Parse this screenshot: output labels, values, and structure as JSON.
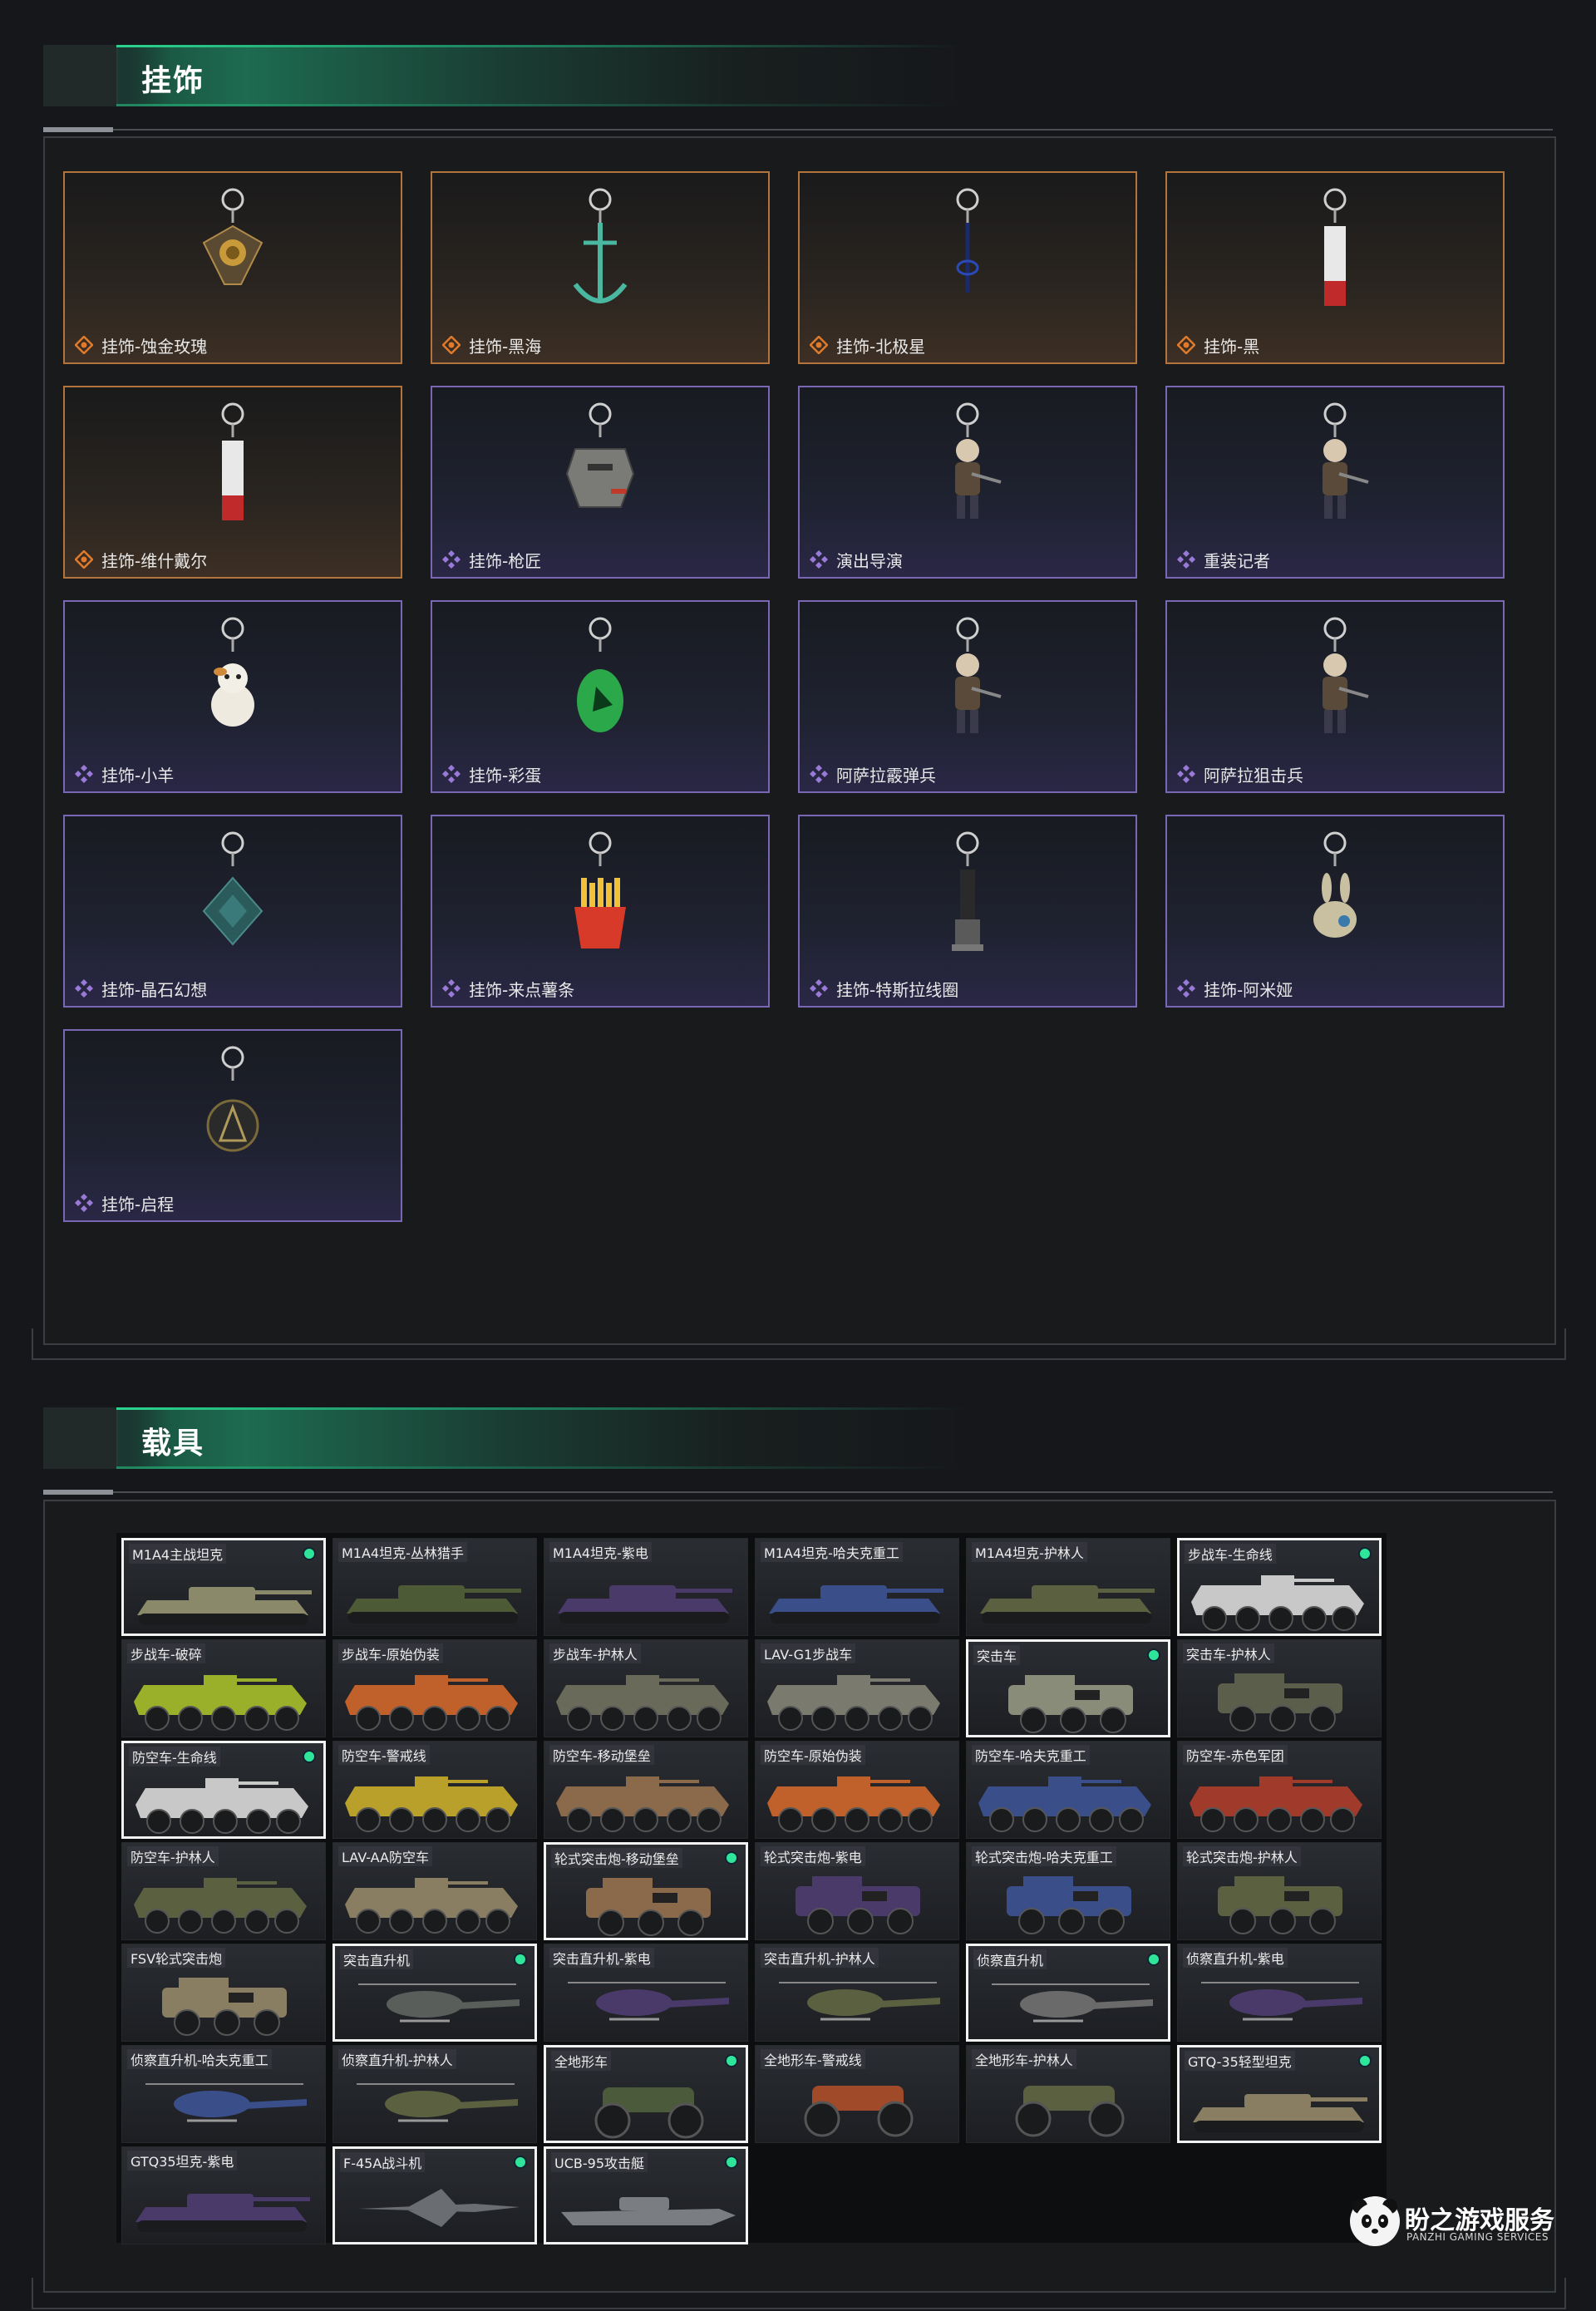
{
  "sections": {
    "charms_title": "挂饰",
    "vehicles_title": "载具"
  },
  "charms": [
    {
      "label": "挂饰-蚀金玫瑰",
      "rarity": "gold",
      "icon": "rose-pendant"
    },
    {
      "label": "挂饰-黑海",
      "rarity": "gold",
      "icon": "anchor-pendant"
    },
    {
      "label": "挂饰-北极星",
      "rarity": "gold",
      "icon": "star-pendant"
    },
    {
      "label": "挂饰-黑",
      "rarity": "gold",
      "icon": "tag-pendant"
    },
    {
      "label": "挂饰-维什戴尔",
      "rarity": "gold",
      "icon": "tag-pendant"
    },
    {
      "label": "挂饰-枪匠",
      "rarity": "purple",
      "icon": "armor-pendant"
    },
    {
      "label": "演出导演",
      "rarity": "purple",
      "icon": "soldier-figure"
    },
    {
      "label": "重装记者",
      "rarity": "purple",
      "icon": "soldier-figure"
    },
    {
      "label": "挂饰-小羊",
      "rarity": "purple",
      "icon": "sheep-pendant"
    },
    {
      "label": "挂饰-彩蛋",
      "rarity": "purple",
      "icon": "egg-pendant"
    },
    {
      "label": "阿萨拉霰弹兵",
      "rarity": "purple",
      "icon": "soldier-figure"
    },
    {
      "label": "阿萨拉狙击兵",
      "rarity": "purple",
      "icon": "soldier-figure"
    },
    {
      "label": "挂饰-晶石幻想",
      "rarity": "purple",
      "icon": "crystal-pendant"
    },
    {
      "label": "挂饰-来点薯条",
      "rarity": "purple",
      "icon": "fries-pendant"
    },
    {
      "label": "挂饰-特斯拉线圈",
      "rarity": "purple",
      "icon": "coil-pendant"
    },
    {
      "label": "挂饰-阿米娅",
      "rarity": "purple",
      "icon": "bunny-pendant"
    },
    {
      "label": "挂饰-启程",
      "rarity": "purple",
      "icon": "emblem-pendant"
    }
  ],
  "vehicles": [
    {
      "label": "M1A4主战坦克",
      "selected": true,
      "dot": true,
      "kind": "tank",
      "color": "#8a8a6a"
    },
    {
      "label": "M1A4坦克-丛林猎手",
      "selected": false,
      "dot": false,
      "kind": "tank",
      "color": "#4c5a36"
    },
    {
      "label": "M1A4坦克-紫电",
      "selected": false,
      "dot": false,
      "kind": "tank",
      "color": "#4a3a6a"
    },
    {
      "label": "M1A4坦克-哈夫克重工",
      "selected": false,
      "dot": false,
      "kind": "tank",
      "color": "#3a4e8a"
    },
    {
      "label": "M1A4坦克-护林人",
      "selected": false,
      "dot": false,
      "kind": "tank",
      "color": "#5a6040"
    },
    {
      "label": "步战车-生命线",
      "selected": true,
      "dot": true,
      "kind": "apc",
      "color": "#c8c8c8"
    },
    {
      "label": "步战车-破碎",
      "selected": false,
      "dot": false,
      "kind": "apc",
      "color": "#9ab02a"
    },
    {
      "label": "步战车-原始伪装",
      "selected": false,
      "dot": false,
      "kind": "apc",
      "color": "#c0602a"
    },
    {
      "label": "步战车-护林人",
      "selected": false,
      "dot": false,
      "kind": "apc",
      "color": "#6a6a5a"
    },
    {
      "label": "LAV-G1步战车",
      "selected": false,
      "dot": false,
      "kind": "apc",
      "color": "#7a7a6e"
    },
    {
      "label": "突击车",
      "selected": true,
      "dot": true,
      "kind": "truck",
      "color": "#8a8c7a"
    },
    {
      "label": "突击车-护林人",
      "selected": false,
      "dot": false,
      "kind": "truck",
      "color": "#5a5e4a"
    },
    {
      "label": "防空车-生命线",
      "selected": true,
      "dot": true,
      "kind": "apc",
      "color": "#c8c8c8"
    },
    {
      "label": "防空车-警戒线",
      "selected": false,
      "dot": false,
      "kind": "apc",
      "color": "#b8a02a"
    },
    {
      "label": "防空车-移动堡垒",
      "selected": false,
      "dot": false,
      "kind": "apc",
      "color": "#8a6a4a"
    },
    {
      "label": "防空车-原始伪装",
      "selected": false,
      "dot": false,
      "kind": "apc",
      "color": "#c0602a"
    },
    {
      "label": "防空车-哈夫克重工",
      "selected": false,
      "dot": false,
      "kind": "apc",
      "color": "#3a4e8a"
    },
    {
      "label": "防空车-赤色军团",
      "selected": false,
      "dot": false,
      "kind": "apc",
      "color": "#a03a2a"
    },
    {
      "label": "防空车-护林人",
      "selected": false,
      "dot": false,
      "kind": "apc",
      "color": "#5a6040"
    },
    {
      "label": "LAV-AA防空车",
      "selected": false,
      "dot": false,
      "kind": "apc",
      "color": "#8a7e62"
    },
    {
      "label": "轮式突击炮-移动堡垒",
      "selected": true,
      "dot": true,
      "kind": "truck",
      "color": "#8a6a4a"
    },
    {
      "label": "轮式突击炮-紫电",
      "selected": false,
      "dot": false,
      "kind": "truck",
      "color": "#4a3a6a"
    },
    {
      "label": "轮式突击炮-哈夫克重工",
      "selected": false,
      "dot": false,
      "kind": "truck",
      "color": "#3a4e8a"
    },
    {
      "label": "轮式突击炮-护林人",
      "selected": false,
      "dot": false,
      "kind": "truck",
      "color": "#5a6040"
    },
    {
      "label": "FSV轮式突击炮",
      "selected": false,
      "dot": false,
      "kind": "truck",
      "color": "#8a7e62"
    },
    {
      "label": "突击直升机",
      "selected": true,
      "dot": true,
      "kind": "heli",
      "color": "#5a5e5a"
    },
    {
      "label": "突击直升机-紫电",
      "selected": false,
      "dot": false,
      "kind": "heli",
      "color": "#4a3a6a"
    },
    {
      "label": "突击直升机-护林人",
      "selected": false,
      "dot": false,
      "kind": "heli",
      "color": "#5a6040"
    },
    {
      "label": "侦察直升机",
      "selected": true,
      "dot": true,
      "kind": "heli",
      "color": "#6a6a6a"
    },
    {
      "label": "侦察直升机-紫电",
      "selected": false,
      "dot": false,
      "kind": "heli",
      "color": "#4a3a6a"
    },
    {
      "label": "侦察直升机-哈夫克重工",
      "selected": false,
      "dot": false,
      "kind": "heli",
      "color": "#3a4e8a"
    },
    {
      "label": "侦察直升机-护林人",
      "selected": false,
      "dot": false,
      "kind": "heli",
      "color": "#5a6040"
    },
    {
      "label": "全地形车",
      "selected": true,
      "dot": true,
      "kind": "atv",
      "color": "#4a5a3a"
    },
    {
      "label": "全地形车-警戒线",
      "selected": false,
      "dot": false,
      "kind": "atv",
      "color": "#a04a2a"
    },
    {
      "label": "全地形车-护林人",
      "selected": false,
      "dot": false,
      "kind": "atv",
      "color": "#5a6040"
    },
    {
      "label": "GTQ-35轻型坦克",
      "selected": true,
      "dot": true,
      "kind": "tank",
      "color": "#8a7e62"
    },
    {
      "label": "GTQ35坦克-紫电",
      "selected": false,
      "dot": false,
      "kind": "tank",
      "color": "#4a3a6a"
    },
    {
      "label": "F-45A战斗机",
      "selected": true,
      "dot": true,
      "kind": "jet",
      "color": "#6a6e72"
    },
    {
      "label": "UCB-95攻击艇",
      "selected": true,
      "dot": true,
      "kind": "boat",
      "color": "#7a7e82"
    }
  ],
  "brand": {
    "name_cn": "盼之游戏服务",
    "name_en": "PANZHI GAMING SERVICES",
    "logo": "panda-logo"
  }
}
